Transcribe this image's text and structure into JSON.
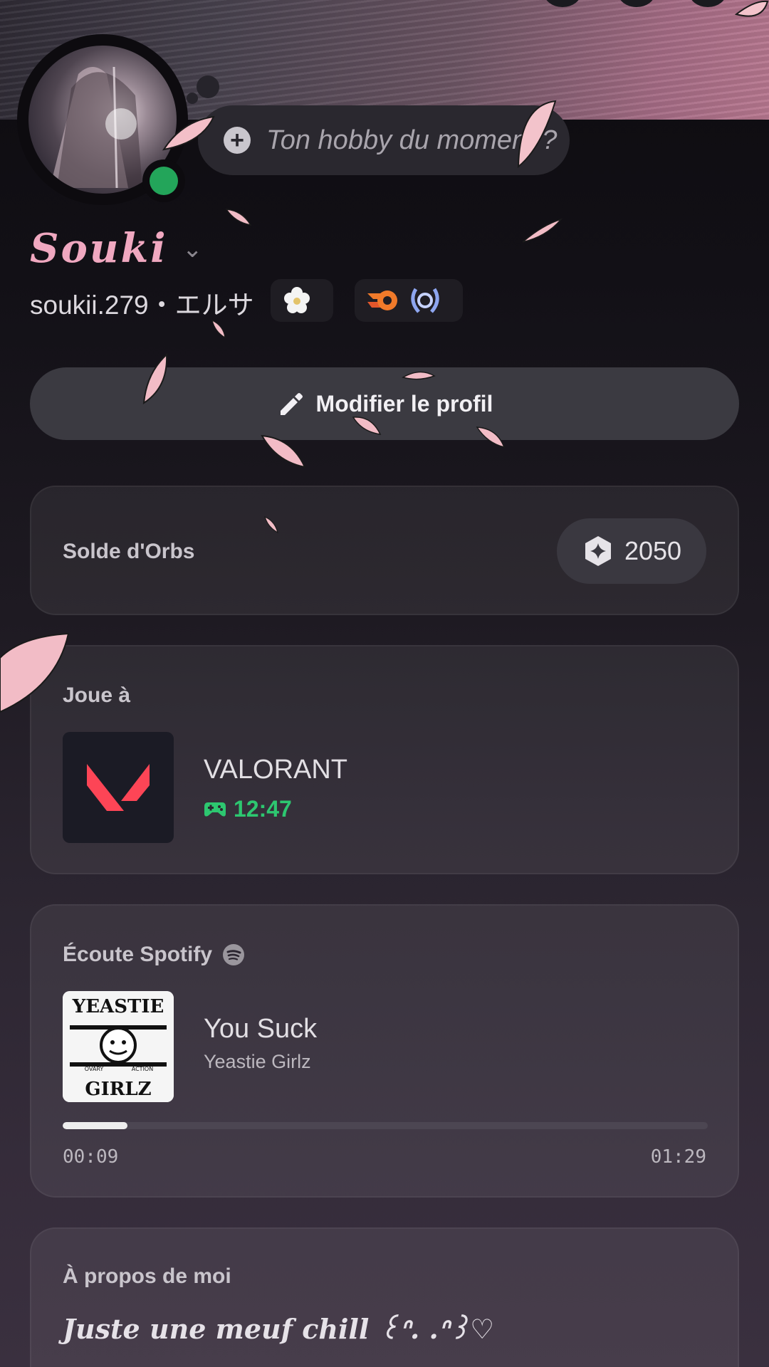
{
  "profile": {
    "display_name": "Souki",
    "handle": "soukii.279・エルサ",
    "hobby_placeholder": "Ton hobby du moment ?",
    "status": "online",
    "badges": [
      "flower-badge",
      "orb-badge",
      "laurel-badge"
    ]
  },
  "actions": {
    "edit_profile": "Modifier le profil"
  },
  "orbs": {
    "label": "Solde d'Orbs",
    "balance": "2050"
  },
  "game": {
    "label": "Joue à",
    "name": "VALORANT",
    "elapsed": "12:47"
  },
  "spotify": {
    "label": "Écoute Spotify",
    "track": "You Suck",
    "artist": "Yeastie Girlz",
    "album_text_top": "YEASTIE",
    "album_text_bottom": "GIRLZ",
    "album_text_middle_left": "OVARY",
    "album_text_middle_right": "ACTION",
    "elapsed": "00:09",
    "duration": "01:29",
    "progress_fraction": 0.1
  },
  "about": {
    "label": "À propos de moi",
    "text": "Juste une meuf chill ꒰ᐢ. .ᐢ꒱♡"
  },
  "colors": {
    "accent_pink": "#f0a8c0",
    "online_green": "#23a55a",
    "game_time_green": "#2dc770",
    "valorant_red": "#fd4556"
  }
}
